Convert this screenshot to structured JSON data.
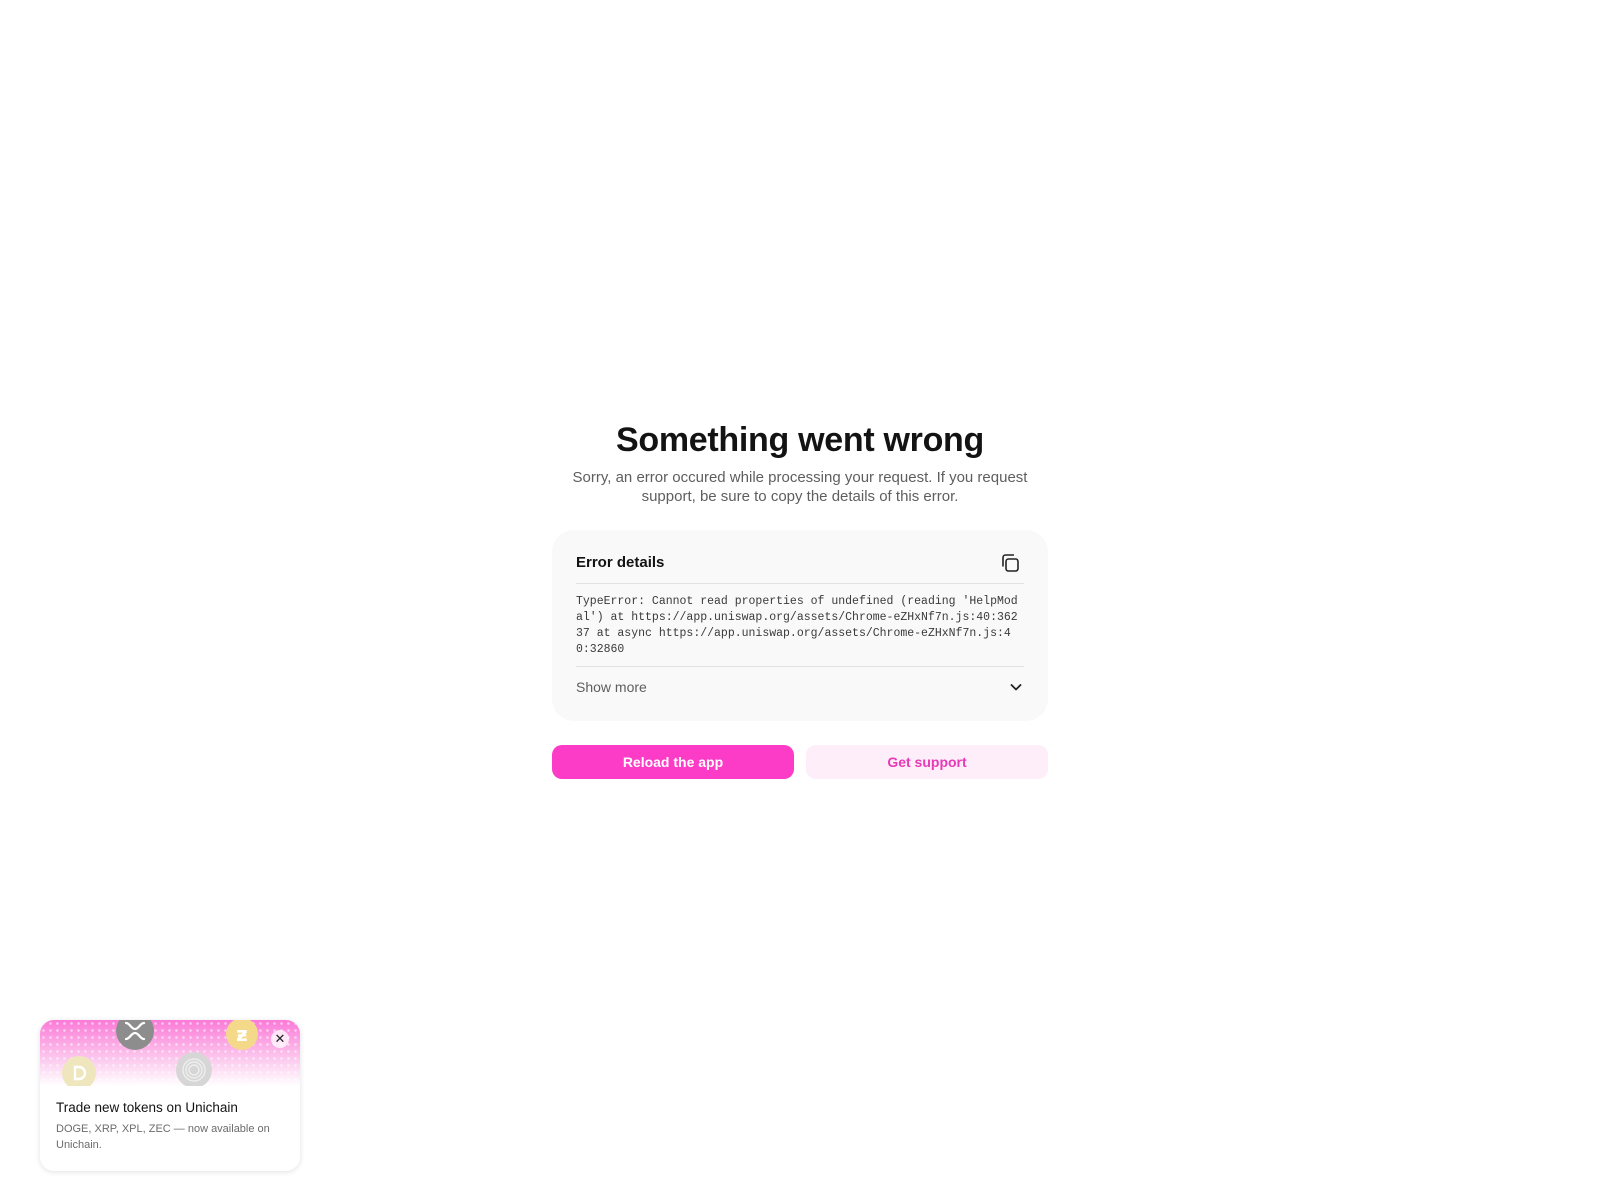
{
  "error": {
    "title": "Something went wrong",
    "subtitle": "Sorry, an error occured while processing your request. If you request support, be sure to copy the details of this error."
  },
  "details": {
    "heading": "Error details",
    "copy_icon": "copy-icon",
    "trace": "TypeError: Cannot read properties of undefined (reading 'HelpModal') at https://app.uniswap.org/assets/Chrome-eZHxNf7n.js:40:36237 at async https://app.uniswap.org/assets/Chrome-eZHxNf7n.js:40:32860",
    "show_more_label": "Show more",
    "chevron_icon": "chevron-down-icon"
  },
  "actions": {
    "reload_label": "Reload the app",
    "support_label": "Get support"
  },
  "promo": {
    "title": "Trade new tokens on Unichain",
    "text": "DOGE, XRP, XPL, ZEC — now available on Unichain.",
    "close_glyph": "✕",
    "coins": [
      "xrp-coin-icon",
      "zec-coin-icon",
      "doge-coin-icon",
      "xpl-coin-icon"
    ]
  },
  "colors": {
    "accent": "#fc3bc6",
    "accent_soft": "#fdeefa",
    "accent_text": "#e73ab6",
    "card_bg": "#f9f9f9"
  }
}
